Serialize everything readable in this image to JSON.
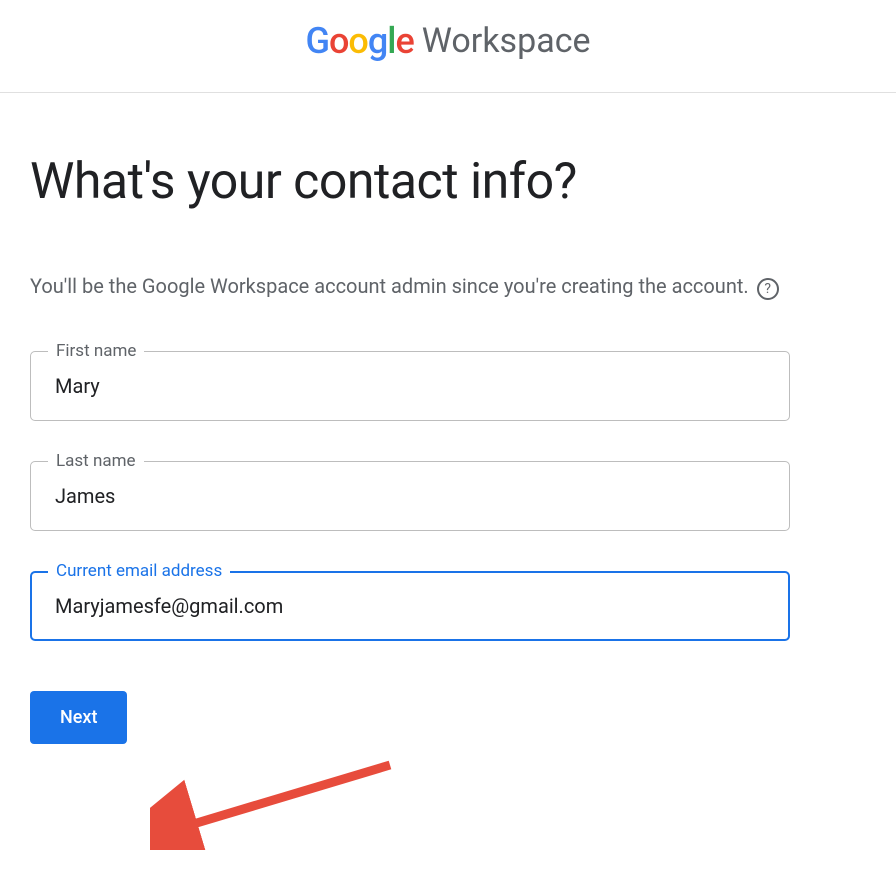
{
  "header": {
    "logo_google": "Google",
    "logo_workspace": "Workspace"
  },
  "main": {
    "title": "What's your contact info?",
    "subtitle": "You'll be the Google Workspace account admin since you're creating the account.",
    "fields": {
      "first_name": {
        "label": "First name",
        "value": "Mary"
      },
      "last_name": {
        "label": "Last name",
        "value": "James"
      },
      "email": {
        "label": "Current email address",
        "value": "Maryjamesfe@gmail.com"
      }
    },
    "next_button": "Next"
  }
}
